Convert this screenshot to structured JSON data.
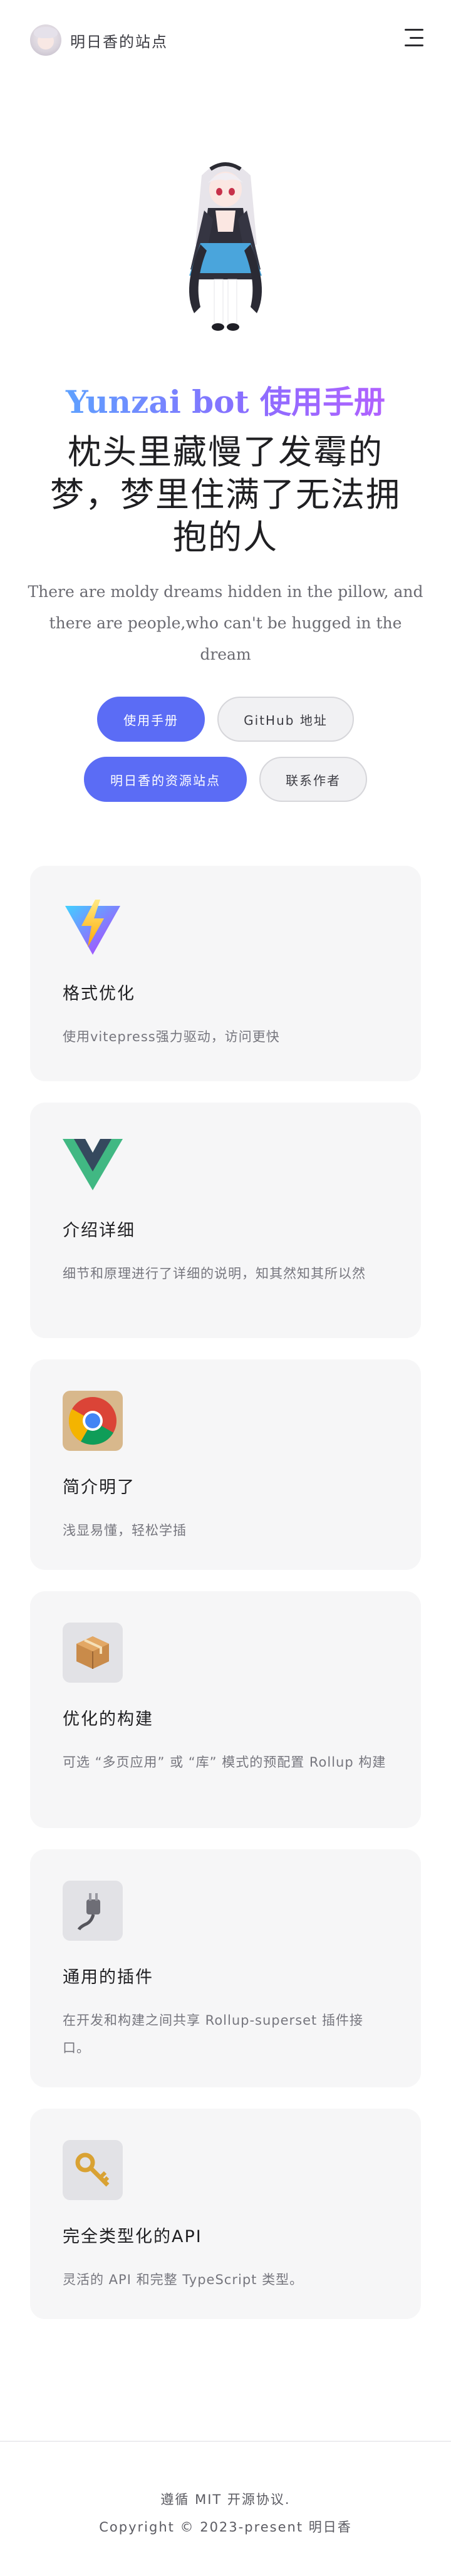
{
  "nav": {
    "title": "明日香的站点",
    "logo_icon": "avatar-logo",
    "menu_icon": "hamburger-menu-icon"
  },
  "hero": {
    "name": "Yunzai bot 使用手册",
    "text": "枕头里藏慢了发霉的梦，梦里住满了无法拥抱的人",
    "tagline": "There are moldy dreams hidden in the pillow, and there are people,who can't be hugged in the dream",
    "image_icon": "anime-character-image",
    "name_gradient": [
      "#4fb3ff",
      "#8a6dff",
      "#c45cff"
    ]
  },
  "actions": [
    {
      "label": "使用手册",
      "theme": "brand"
    },
    {
      "label": "GitHub 地址",
      "theme": "alt"
    },
    {
      "label": "明日香的资源站点",
      "theme": "brand"
    },
    {
      "label": "联系作者",
      "theme": "alt"
    }
  ],
  "features": [
    {
      "icon": "vite-logo-icon",
      "title": "格式优化",
      "details": "使用vitepress强力驱动，访问更快"
    },
    {
      "icon": "vue-logo-icon",
      "title": "介绍详细",
      "details": "细节和原理进行了详细的说明，知其然知其所以然"
    },
    {
      "icon": "chrome-logo-icon",
      "title": "简介明了",
      "details": "浅显易懂，轻松学插"
    },
    {
      "icon": "package-icon",
      "title": "优化的构建",
      "details": "可选 “多页应用” 或 “库” 模式的预配置 Rollup 构建"
    },
    {
      "icon": "plug-icon",
      "title": "通用的插件",
      "details": "在开发和构建之间共享 Rollup-superset 插件接口。"
    },
    {
      "icon": "key-icon",
      "title": "完全类型化的API",
      "details": "灵活的 API 和完整 TypeScript 类型。"
    }
  ],
  "footer": {
    "message": "遵循 MIT 开源协议.",
    "copyright": "Copyright © 2023-present 明日香"
  },
  "colors": {
    "brand": "#5b6cf5",
    "card_bg": "#f6f6f7",
    "text": "#3c3c43"
  }
}
